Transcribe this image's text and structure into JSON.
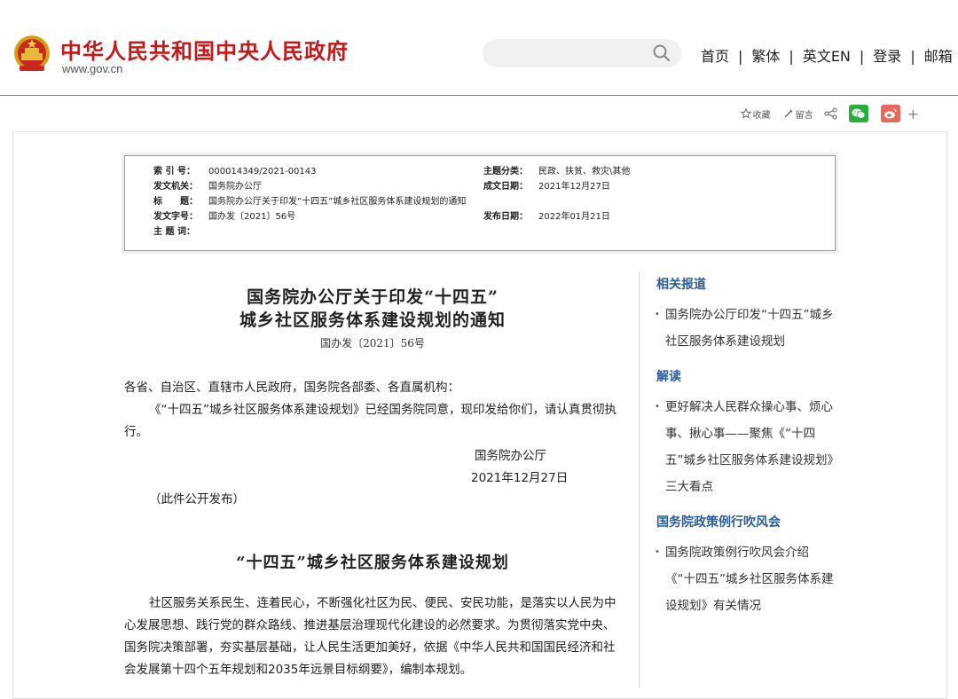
{
  "header": {
    "site_name": "中华人民共和国中央人民政府",
    "site_url": "www.gov.cn",
    "search": {
      "placeholder": "",
      "value": ""
    },
    "nav": [
      "首页",
      "繁体",
      "英文EN",
      "登录",
      "邮箱"
    ]
  },
  "share": {
    "favorite_label": "收藏",
    "comment_label": "留言",
    "plus": "+"
  },
  "meta": {
    "index_label": "索 引 号：",
    "index_value": "000014349/2021-00143",
    "category_label": "主题分类：",
    "category_value": "民政、扶贫、救灾\\其他",
    "issuer_label": "发文机关：",
    "issuer_value": "国务院办公厅",
    "written_label": "成文日期：",
    "written_value": "2021年12月27日",
    "title_label": "标　　题：",
    "title_value": "国务院办公厅关于印发“十四五”城乡社区服务体系建设规划的通知",
    "docno_label": "发文字号：",
    "docno_value": "国办发〔2021〕56号",
    "published_label": "发布日期：",
    "published_value": "2022年01月21日",
    "keywords_label": "主 题 词：",
    "keywords_value": ""
  },
  "article": {
    "title_line1": "国务院办公厅关于印发“十四五”",
    "title_line2": "城乡社区服务体系建设规划的通知",
    "docno": "国办发〔2021〕56号",
    "salutation": "各省、自治区、直辖市人民政府，国务院各部委、各直属机构：",
    "body": "《“十四五”城乡社区服务体系建设规划》已经国务院同意，现印发给你们，请认真贯彻执行。",
    "signer": "国务院办公厅",
    "date": "2021年12月27日",
    "note": "（此件公开发布）",
    "subtitle": "“十四五”城乡社区服务体系建设规划",
    "para": "社区服务关系民生、连着民心，不断强化社区为民、便民、安民功能，是落实以人民为中心发展思想、践行党的群众路线、推进基层治理现代化建设的必然要求。为贯彻落实党中央、国务院决策部署，夯实基层基础，让人民生活更加美好，依据《中华人民共和国国民经济和社会发展第十四个五年规划和2035年远景目标纲要》，编制本规划。"
  },
  "sidebar": {
    "related_title": "相关报道",
    "related_items": [
      "国务院办公厅印发“十四五”城乡社区服务体系建设规划"
    ],
    "interp_title": "解读",
    "interp_items": [
      "更好解决人民群众操心事、烦心事、揪心事——聚焦《“十四五”城乡社区服务体系建设规划》三大看点"
    ],
    "briefing_title": "国务院政策例行吹风会",
    "briefing_items": [
      "国务院政策例行吹风会介绍《“十四五”城乡社区服务体系建设规划》有关情况"
    ]
  },
  "colors": {
    "brand_red": "#c21a1a",
    "side_title_blue": "#2b5c9a"
  }
}
